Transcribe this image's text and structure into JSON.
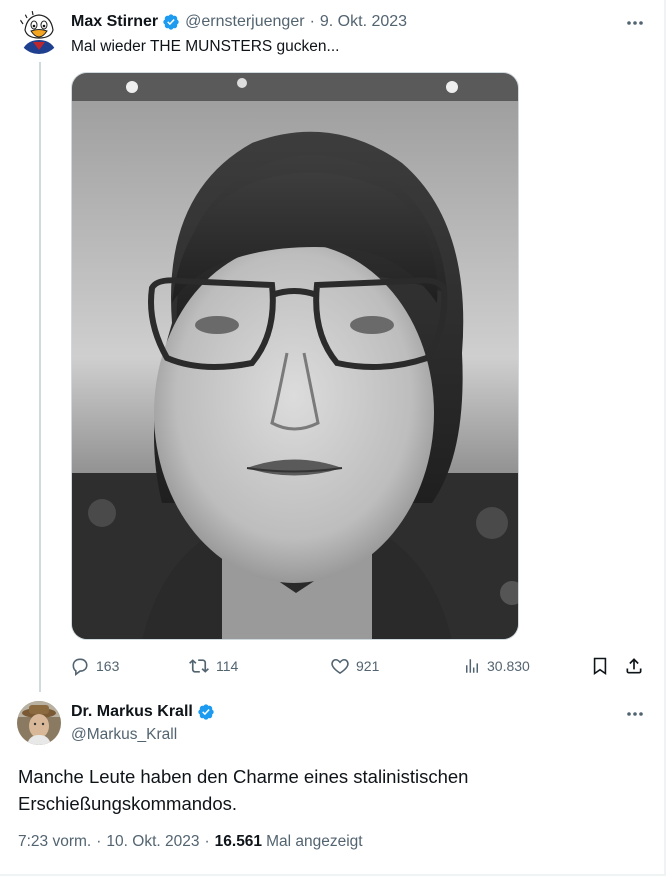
{
  "tweet1": {
    "display_name": "Max Stirner",
    "handle": "@ernsterjuenger",
    "separator": "·",
    "date": "9. Okt. 2023",
    "text": "Mal wieder THE MUNSTERS gucken...",
    "avatar_icon": "cartoon-duck-avatar",
    "more_icon": "more-icon",
    "actions": {
      "replies": "163",
      "retweets": "114",
      "likes": "921",
      "views": "30.830"
    }
  },
  "tweet2": {
    "display_name": "Dr. Markus Krall",
    "handle": "@Markus_Krall",
    "line1": "Manche Leute haben den Charme eines stalinistischen",
    "line2": "Erschießungskommandos.",
    "time": "7:23 vorm.",
    "separator": "·",
    "date": "10. Okt. 2023",
    "views": "16.561",
    "views_label": "Mal angezeigt"
  },
  "colors": {
    "verified": "#1d9bf0",
    "secondary_text": "#536471",
    "primary_text": "#0f1419",
    "border": "#cfd9de"
  }
}
